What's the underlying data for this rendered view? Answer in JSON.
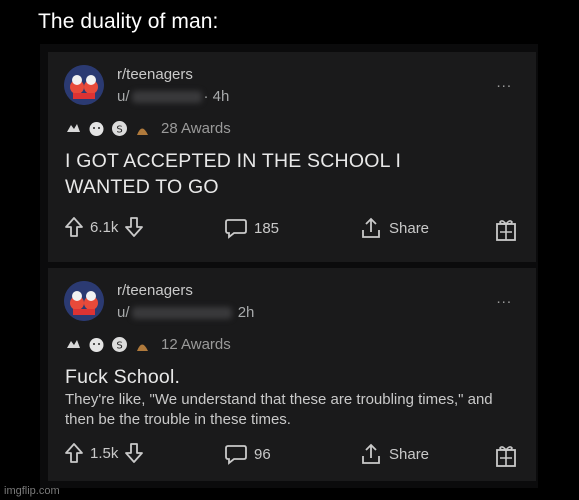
{
  "meme_title": "The duality of man:",
  "posts": [
    {
      "subreddit": "r/teenagers",
      "user_prefix": "u/",
      "time": "· 4h",
      "awards_label": "28 Awards",
      "title": "I GOT ACCEPTED IN THE SCHOOL I WANTED TO GO",
      "body": "",
      "votes": "6.1k",
      "comments": "185",
      "share_label": "Share"
    },
    {
      "subreddit": "r/teenagers",
      "user_prefix": "u/",
      "time": "2h",
      "awards_label": "12 Awards",
      "title": "Fuck School.",
      "body": "They're like, \"We understand that these are troubling times,\" and then be the trouble in these times.",
      "votes": "1.5k",
      "comments": "96",
      "share_label": "Share"
    }
  ],
  "more_label": "...",
  "watermark": "imgflip.com",
  "colors": {
    "background": "#000000",
    "card": "#1a1a1b",
    "text": "#d7dadc",
    "muted": "#a8aaab"
  },
  "icons": [
    "avatar-icon",
    "award-icons",
    "upvote-icon",
    "downvote-icon",
    "comment-icon",
    "share-icon",
    "gift-icon",
    "more-icon"
  ]
}
